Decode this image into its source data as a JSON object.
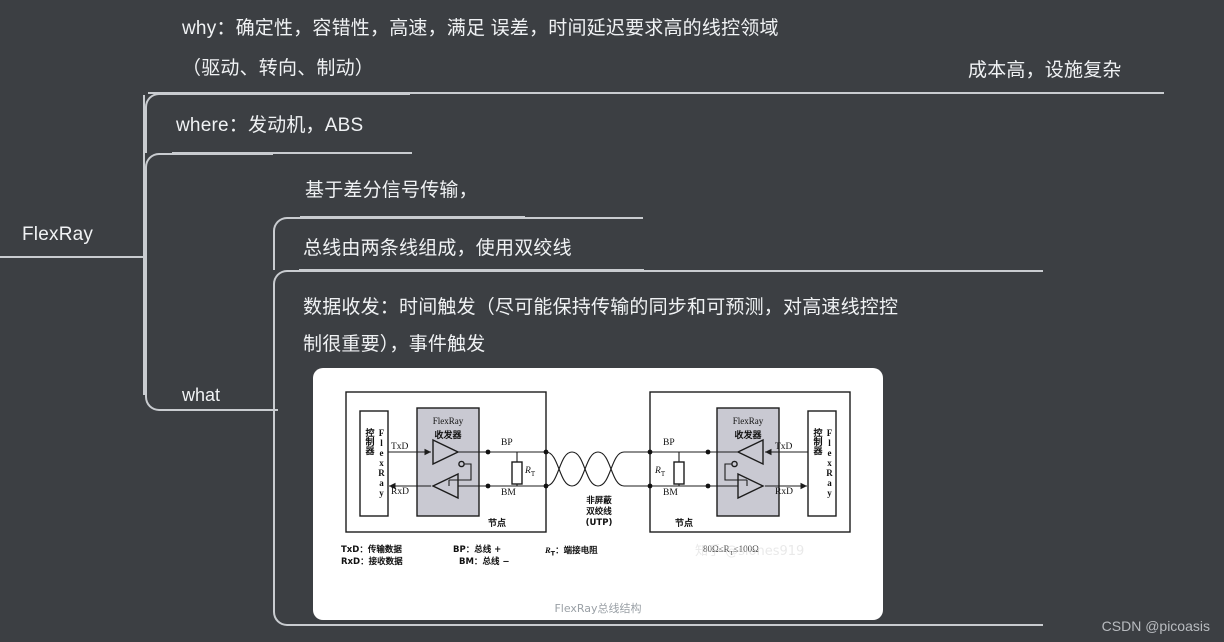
{
  "background_color": "#3c3f43",
  "line_color": "#c9ccd0",
  "text_color": "#f0f2f4",
  "root": {
    "label": "FlexRay"
  },
  "branches": {
    "why": {
      "line1": "why：确定性，容错性，高速，满足 误差，时间延迟要求高的线控领域",
      "line2": "（驱动、转向、制动）"
    },
    "cost": {
      "label": "成本高，设施复杂"
    },
    "where": {
      "label": "where：发动机，ABS"
    },
    "what": {
      "label": "what",
      "children": [
        {
          "label": "基于差分信号传输，"
        },
        {
          "label": "总线由两条线组成，使用双绞线"
        },
        {
          "line1": "数据收发：时间触发（尽可能保持传输的同步和可预测，对高速线控控",
          "line2": "制很重要），事件触发"
        }
      ]
    }
  },
  "figure": {
    "caption": "FlexRay总线结构",
    "watermark": "知乎 @siones919",
    "resistor_note": "80Ω≤R",
    "resistor_note_sub": "T",
    "resistor_note_tail": "≤100Ω",
    "left_node": {
      "controller": "FlexRay 控制器",
      "controller_line1": "FlexRay",
      "controller_line2": "控制器",
      "transceiver_line1": "FlexRay",
      "transceiver_line2": "收发器",
      "txd": "TxD",
      "rxd": "RxD",
      "bp": "BP",
      "bm": "BM",
      "rt": "R",
      "rt_sub": "T",
      "node_label": "节点"
    },
    "right_node": {
      "controller_line1": "FlexRay",
      "controller_line2": "控制器",
      "transceiver_line1": "FlexRay",
      "transceiver_line2": "收发器",
      "txd": "TxD",
      "rxd": "RxD",
      "bp": "BP",
      "bm": "BM",
      "rt": "R",
      "rt_sub": "T",
      "node_label": "节点"
    },
    "cable": {
      "line1": "非屏蔽",
      "line2": "双绞线",
      "line3": "(UTP)"
    },
    "legend": [
      {
        "key": "TxD：",
        "value": "传输数据"
      },
      {
        "key": "RxD：",
        "value": "接收数据"
      },
      {
        "key": "BP：",
        "value": "总线 +"
      },
      {
        "key": "BM：",
        "value": "总线 −"
      },
      {
        "key": "R",
        "key_sub": "T",
        "key_tail": "：",
        "value": "端接电阻"
      }
    ]
  },
  "credit": "CSDN @picoasis"
}
